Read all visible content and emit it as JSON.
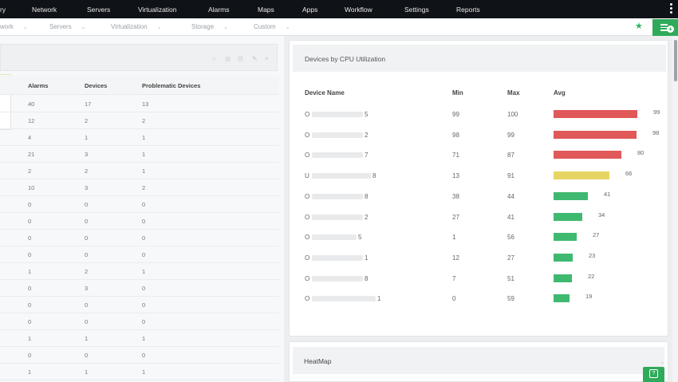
{
  "topnav": {
    "items": [
      "ry",
      "Network",
      "Servers",
      "Virtualization",
      "Alarms",
      "Maps",
      "Apps",
      "Workflow",
      "Settings",
      "Reports"
    ]
  },
  "subnav": {
    "items": [
      "work",
      "Servers",
      "Virtualization",
      "Storage",
      "Custom"
    ],
    "chevron": "⌄",
    "star_icon": "star-icon"
  },
  "left_table": {
    "headers": [
      "Alarms",
      "Devices",
      "Problematic Devices"
    ],
    "rows": [
      [
        "40",
        "17",
        "13"
      ],
      [
        "12",
        "2",
        "2"
      ],
      [
        "4",
        "1",
        "1"
      ],
      [
        "21",
        "3",
        "1"
      ],
      [
        "2",
        "2",
        "1"
      ],
      [
        "10",
        "3",
        "2"
      ],
      [
        "0",
        "0",
        "0"
      ],
      [
        "0",
        "0",
        "0"
      ],
      [
        "0",
        "0",
        "0"
      ],
      [
        "0",
        "0",
        "0"
      ],
      [
        "1",
        "2",
        "1"
      ],
      [
        "0",
        "3",
        "0"
      ],
      [
        "0",
        "0",
        "0"
      ],
      [
        "0",
        "0",
        "0"
      ],
      [
        "1",
        "1",
        "1"
      ],
      [
        "0",
        "0",
        "0"
      ],
      [
        "1",
        "1",
        "1"
      ]
    ],
    "flag_label": "+"
  },
  "cpu_card": {
    "title": "Devices by CPU Utilization",
    "headers": [
      "Device Name",
      "Min",
      "Max",
      "Avg"
    ],
    "rows": [
      {
        "initial": "O",
        "suffix": "5",
        "min": "99",
        "max": "100",
        "avg": 99
      },
      {
        "initial": "O",
        "suffix": "2",
        "min": "98",
        "max": "99",
        "avg": 98
      },
      {
        "initial": "O",
        "suffix": "7",
        "min": "71",
        "max": "87",
        "avg": 80
      },
      {
        "initial": "U",
        "suffix": "8",
        "min": "13",
        "max": "91",
        "avg": 66
      },
      {
        "initial": "O",
        "suffix": "8",
        "min": "38",
        "max": "44",
        "avg": 41
      },
      {
        "initial": "O",
        "suffix": "2",
        "min": "27",
        "max": "41",
        "avg": 34
      },
      {
        "initial": "O",
        "suffix": "5",
        "min": "1",
        "max": "56",
        "avg": 27
      },
      {
        "initial": "O",
        "suffix": "1",
        "min": "12",
        "max": "27",
        "avg": 23
      },
      {
        "initial": "O",
        "suffix": "8",
        "min": "7",
        "max": "51",
        "avg": 22
      },
      {
        "initial": "O",
        "suffix": "1",
        "min": "0",
        "max": "59",
        "avg": 19
      }
    ],
    "colors": {
      "high": "#e05858",
      "medium": "#e6d563",
      "low": "#3fb970"
    }
  },
  "heatmap_card": {
    "title": "HeatMap"
  }
}
